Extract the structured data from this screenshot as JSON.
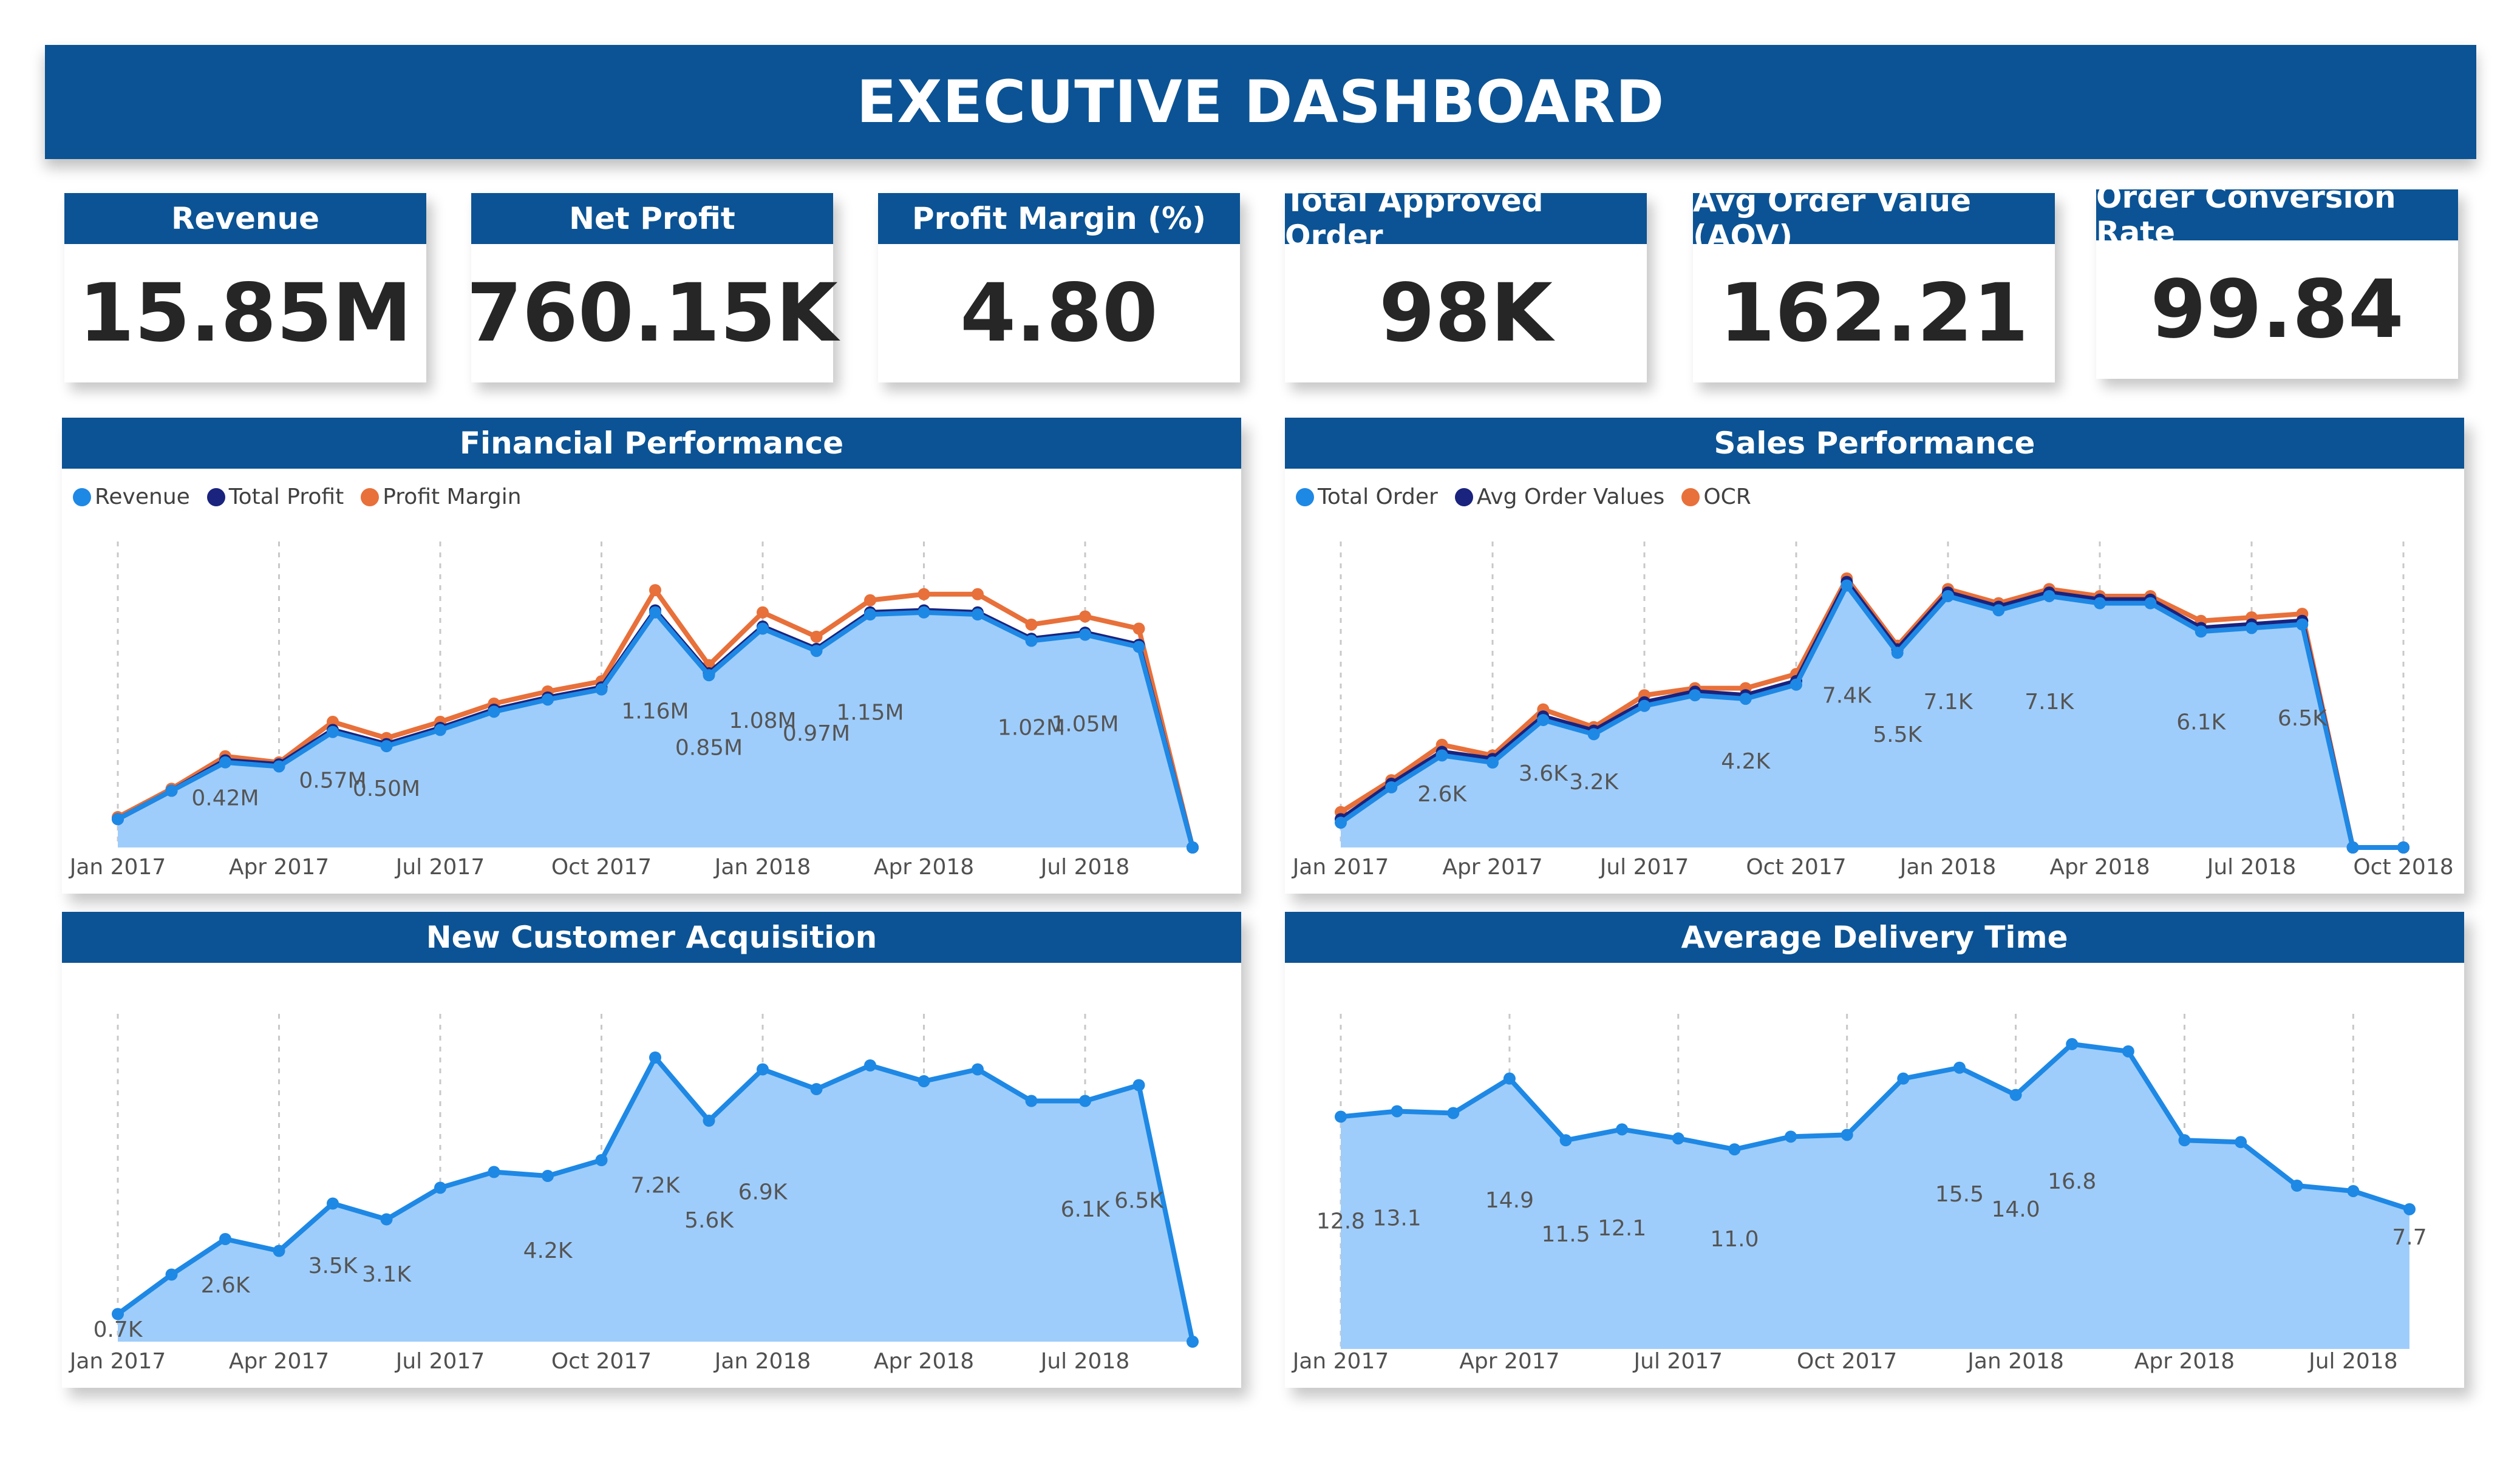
{
  "title": "EXECUTIVE DASHBOARD",
  "kpis": [
    {
      "label": "Revenue",
      "value": "15.85M"
    },
    {
      "label": "Net Profit",
      "value": "760.15K"
    },
    {
      "label": "Profit Margin (%)",
      "value": "4.80"
    },
    {
      "label": "Total Approved Order",
      "value": "98K"
    },
    {
      "label": "Avg Order Value (AOV)",
      "value": "162.21"
    },
    {
      "label": "Order Conversion Rate",
      "value": "99.84"
    }
  ],
  "colors": {
    "header": "#0b5394",
    "area": "#9fcdfb",
    "line": "#1e88e5",
    "dark": "#1a237e",
    "orange": "#e8703a"
  },
  "panels": {
    "financial": {
      "title": "Financial Performance",
      "legend": [
        "Revenue",
        "Total Profit",
        "Profit Margin"
      ]
    },
    "sales": {
      "title": "Sales Performance",
      "legend": [
        "Total Order",
        "Avg Order Values",
        "OCR"
      ]
    },
    "customers": {
      "title": "New Customer Acquisition"
    },
    "delivery": {
      "title": "Average Delivery Time"
    }
  },
  "chart_data": [
    {
      "id": "financial",
      "type": "area",
      "title": "Financial Performance",
      "x": [
        "2017-01",
        "2017-02",
        "2017-03",
        "2017-04",
        "2017-05",
        "2017-06",
        "2017-07",
        "2017-08",
        "2017-09",
        "2017-10",
        "2017-11",
        "2017-12",
        "2018-01",
        "2018-02",
        "2018-03",
        "2018-04",
        "2018-05",
        "2018-06",
        "2018-07",
        "2018-08",
        "2018-09"
      ],
      "x_ticks": [
        "Jan 2017",
        "Apr 2017",
        "Jul 2017",
        "Oct 2017",
        "Jan 2018",
        "Apr 2018",
        "Jul 2018"
      ],
      "series": [
        {
          "name": "Revenue",
          "values": [
            0.14,
            0.28,
            0.42,
            0.4,
            0.57,
            0.5,
            0.58,
            0.67,
            0.73,
            0.78,
            1.16,
            0.85,
            1.08,
            0.97,
            1.15,
            1.16,
            1.15,
            1.02,
            1.05,
            0.99,
            0.0
          ]
        },
        {
          "name": "Total Profit",
          "values": [
            0.14,
            0.28,
            0.43,
            0.41,
            0.58,
            0.51,
            0.59,
            0.68,
            0.74,
            0.79,
            1.17,
            0.86,
            1.09,
            0.98,
            1.16,
            1.17,
            1.16,
            1.03,
            1.06,
            1.0,
            0.0
          ]
        },
        {
          "name": "Profit Margin",
          "values": [
            0.15,
            0.29,
            0.45,
            0.42,
            0.62,
            0.54,
            0.62,
            0.71,
            0.77,
            0.82,
            1.27,
            0.9,
            1.16,
            1.04,
            1.22,
            1.25,
            1.25,
            1.1,
            1.14,
            1.08,
            0.0
          ]
        }
      ],
      "data_labels": [
        "",
        "",
        "0.42M",
        "",
        "0.57M",
        "0.50M",
        "",
        "",
        "",
        "",
        "1.16M",
        "0.85M",
        "1.08M",
        "0.97M",
        "1.15M",
        "",
        "",
        "1.02M",
        "1.05M",
        "",
        ""
      ],
      "ylim": [
        0,
        1.45
      ]
    },
    {
      "id": "sales",
      "type": "area",
      "title": "Sales Performance",
      "x": [
        "2017-01",
        "2017-02",
        "2017-03",
        "2017-04",
        "2017-05",
        "2017-06",
        "2017-07",
        "2017-08",
        "2017-09",
        "2017-10",
        "2017-11",
        "2017-12",
        "2018-01",
        "2018-02",
        "2018-03",
        "2018-04",
        "2018-05",
        "2018-06",
        "2018-07",
        "2018-08",
        "2018-09",
        "2018-10"
      ],
      "x_ticks": [
        "Jan 2017",
        "Apr 2017",
        "Jul 2017",
        "Oct 2017",
        "Jan 2018",
        "Apr 2018",
        "Jul 2018",
        "Oct 2018"
      ],
      "series": [
        {
          "name": "Total Order",
          "values": [
            0.7,
            1.7,
            2.6,
            2.4,
            3.6,
            3.2,
            4.0,
            4.3,
            4.2,
            4.6,
            7.4,
            5.5,
            7.1,
            6.7,
            7.1,
            6.9,
            6.9,
            6.1,
            6.2,
            6.3,
            0.0,
            0.0
          ]
        },
        {
          "name": "Avg Order Values",
          "values": [
            0.8,
            1.8,
            2.7,
            2.5,
            3.7,
            3.3,
            4.1,
            4.4,
            4.3,
            4.7,
            7.5,
            5.6,
            7.2,
            6.8,
            7.2,
            7.0,
            7.0,
            6.2,
            6.3,
            6.4,
            0.0,
            0.0
          ]
        },
        {
          "name": "OCR",
          "values": [
            1.0,
            1.9,
            2.9,
            2.6,
            3.9,
            3.4,
            4.3,
            4.5,
            4.5,
            4.9,
            7.6,
            5.7,
            7.3,
            6.9,
            7.3,
            7.1,
            7.1,
            6.4,
            6.5,
            6.6,
            0.0,
            0.0
          ]
        }
      ],
      "data_labels": [
        "",
        "",
        "2.6K",
        "",
        "3.6K",
        "3.2K",
        "",
        "",
        "4.2K",
        "",
        "7.4K",
        "5.5K",
        "7.1K",
        "",
        "7.1K",
        "",
        "",
        "6.1K",
        "",
        "6.5K",
        "",
        ""
      ],
      "ylim": [
        0,
        8.3
      ]
    },
    {
      "id": "customers",
      "type": "area",
      "title": "New Customer Acquisition",
      "x": [
        "2017-01",
        "2017-02",
        "2017-03",
        "2017-04",
        "2017-05",
        "2017-06",
        "2017-07",
        "2017-08",
        "2017-09",
        "2017-10",
        "2017-11",
        "2017-12",
        "2018-01",
        "2018-02",
        "2018-03",
        "2018-04",
        "2018-05",
        "2018-06",
        "2018-07",
        "2018-08",
        "2018-09"
      ],
      "x_ticks": [
        "Jan 2017",
        "Apr 2017",
        "Jul 2017",
        "Oct 2017",
        "Jan 2018",
        "Apr 2018",
        "Jul 2018"
      ],
      "series": [
        {
          "name": "",
          "values": [
            0.7,
            1.7,
            2.6,
            2.3,
            3.5,
            3.1,
            3.9,
            4.3,
            4.2,
            4.6,
            7.2,
            5.6,
            6.9,
            6.4,
            7.0,
            6.6,
            6.9,
            6.1,
            6.1,
            6.5,
            0.0
          ]
        }
      ],
      "data_labels": [
        "0.7K",
        "",
        "2.6K",
        "",
        "3.5K",
        "3.1K",
        "",
        "",
        "4.2K",
        "",
        "7.2K",
        "5.6K",
        "6.9K",
        "",
        "",
        "",
        "",
        "",
        "6.1K",
        "6.5K",
        ""
      ],
      "ylim": [
        0,
        8.0
      ]
    },
    {
      "id": "delivery",
      "type": "area",
      "title": "Average Delivery Time",
      "x": [
        "2017-01",
        "2017-02",
        "2017-03",
        "2017-04",
        "2017-05",
        "2017-06",
        "2017-07",
        "2017-08",
        "2017-09",
        "2017-10",
        "2017-11",
        "2017-12",
        "2018-01",
        "2018-02",
        "2018-03",
        "2018-04",
        "2018-05",
        "2018-06",
        "2018-07",
        "2018-08"
      ],
      "x_ticks": [
        "Jan 2017",
        "Apr 2017",
        "Jul 2017",
        "Oct 2017",
        "Jan 2018",
        "Apr 2018",
        "Jul 2018"
      ],
      "series": [
        {
          "name": "",
          "values": [
            12.8,
            13.1,
            13.0,
            14.9,
            11.5,
            12.1,
            11.6,
            11.0,
            11.7,
            11.8,
            14.9,
            15.5,
            14.0,
            16.8,
            16.4,
            11.5,
            11.4,
            9.0,
            8.7,
            7.7
          ]
        }
      ],
      "data_labels": [
        "12.8",
        "13.1",
        "",
        "14.9",
        "11.5",
        "12.1",
        "",
        "11.0",
        "",
        "",
        "",
        "15.5",
        "14.0",
        "16.8",
        "",
        "",
        "",
        "",
        "",
        "7.7"
      ],
      "ylim": [
        0,
        17.8
      ]
    }
  ]
}
